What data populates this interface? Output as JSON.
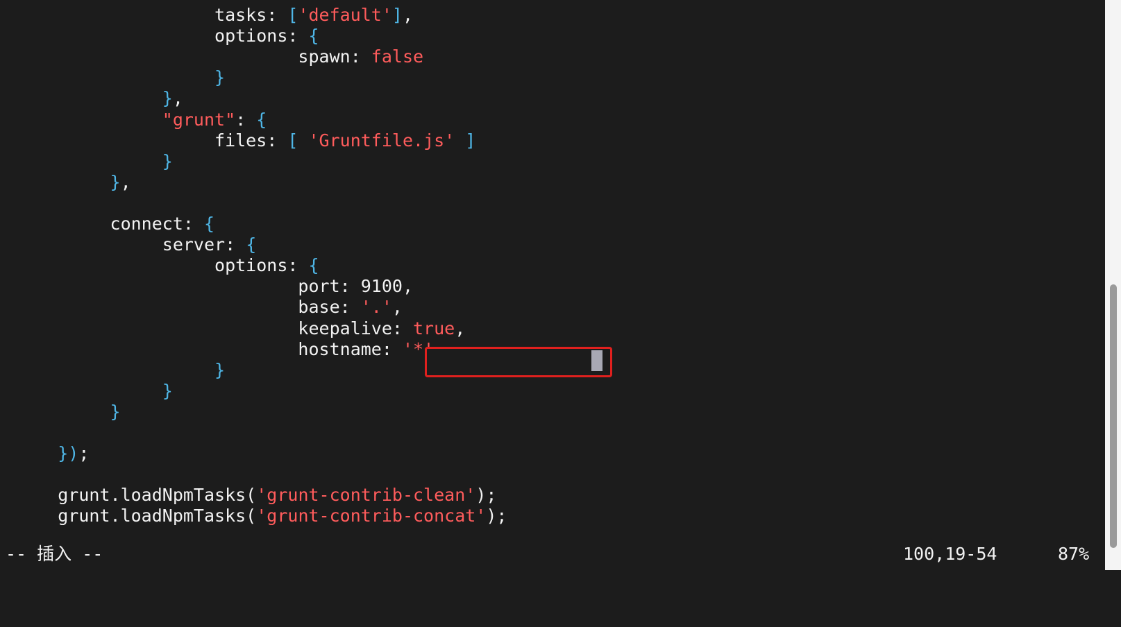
{
  "editor": {
    "lines": [
      [
        {
          "t": "                    tasks: ",
          "c": "p"
        },
        {
          "t": "[",
          "c": "b"
        },
        {
          "t": "'default'",
          "c": "s"
        },
        {
          "t": "]",
          "c": "b"
        },
        {
          "t": ",",
          "c": "p"
        }
      ],
      [
        {
          "t": "                    options: ",
          "c": "p"
        },
        {
          "t": "{",
          "c": "b"
        }
      ],
      [
        {
          "t": "                            spawn: ",
          "c": "p"
        },
        {
          "t": "false",
          "c": "s"
        }
      ],
      [
        {
          "t": "                    }",
          "c": "b"
        }
      ],
      [
        {
          "t": "               }",
          "c": "b"
        },
        {
          "t": ",",
          "c": "p"
        }
      ],
      [
        {
          "t": "               ",
          "c": "p"
        },
        {
          "t": "\"grunt\"",
          "c": "s"
        },
        {
          "t": ": ",
          "c": "p"
        },
        {
          "t": "{",
          "c": "b"
        }
      ],
      [
        {
          "t": "                    files: ",
          "c": "p"
        },
        {
          "t": "[ ",
          "c": "b"
        },
        {
          "t": "'Gruntfile.js'",
          "c": "s"
        },
        {
          "t": " ]",
          "c": "b"
        }
      ],
      [
        {
          "t": "               }",
          "c": "b"
        }
      ],
      [
        {
          "t": "          }",
          "c": "b"
        },
        {
          "t": ",",
          "c": "p"
        }
      ],
      [],
      [
        {
          "t": "          connect: ",
          "c": "p"
        },
        {
          "t": "{",
          "c": "b"
        }
      ],
      [
        {
          "t": "               server: ",
          "c": "p"
        },
        {
          "t": "{",
          "c": "b"
        }
      ],
      [
        {
          "t": "                    options: ",
          "c": "p"
        },
        {
          "t": "{",
          "c": "b"
        }
      ],
      [
        {
          "t": "                            port: 9100,",
          "c": "p"
        }
      ],
      [
        {
          "t": "                            base: ",
          "c": "p"
        },
        {
          "t": "'.'",
          "c": "s"
        },
        {
          "t": ",",
          "c": "p"
        }
      ],
      [
        {
          "t": "                            keepalive: ",
          "c": "p"
        },
        {
          "t": "true",
          "c": "s"
        },
        {
          "t": ",",
          "c": "p"
        }
      ],
      [
        {
          "t": "                            hostname: ",
          "c": "p"
        },
        {
          "t": "'*'",
          "c": "s"
        }
      ],
      [
        {
          "t": "                    }",
          "c": "b"
        }
      ],
      [
        {
          "t": "               }",
          "c": "b"
        }
      ],
      [
        {
          "t": "          }",
          "c": "b"
        }
      ],
      [],
      [
        {
          "t": "     })",
          "c": "b"
        },
        {
          "t": ";",
          "c": "p"
        }
      ],
      [],
      [
        {
          "t": "     grunt.loadNpmTasks(",
          "c": "p"
        },
        {
          "t": "'grunt-contrib-clean'",
          "c": "s"
        },
        {
          "t": ");",
          "c": "p"
        }
      ],
      [
        {
          "t": "     grunt.loadNpmTasks(",
          "c": "p"
        },
        {
          "t": "'grunt-contrib-concat'",
          "c": "s"
        },
        {
          "t": ");",
          "c": "p"
        }
      ]
    ]
  },
  "statusbar": {
    "mode": "-- 插入 --",
    "position": "100,19-54",
    "percent": "87%"
  },
  "colors": {
    "plain": "#f2f2f2",
    "bracket": "#4fb6e6",
    "string": "#ff5c5c",
    "highlight": "#e0201e",
    "background": "#1c1c1c"
  }
}
